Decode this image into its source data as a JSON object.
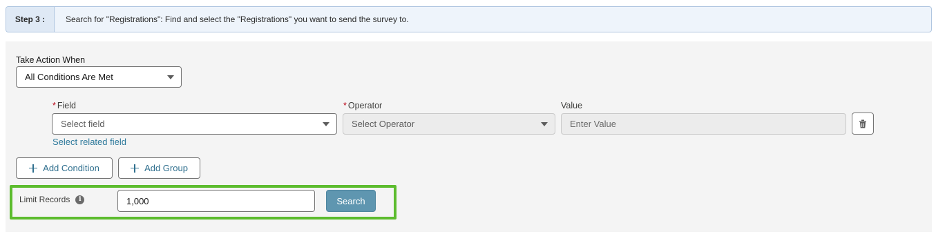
{
  "step": {
    "label": "Step 3 :",
    "instruction": "Search for \"Registrations\": Find and select the \"Registrations\" you want to send the survey to."
  },
  "take_action": {
    "label": "Take Action When",
    "value": "All Conditions Are Met"
  },
  "condition": {
    "field_label": "Field",
    "field_placeholder": "Select field",
    "related_link": "Select related field",
    "operator_label": "Operator",
    "operator_placeholder": "Select Operator",
    "value_label": "Value",
    "value_placeholder": "Enter Value",
    "required_marker": "*"
  },
  "actions": {
    "add_condition": "Add Condition",
    "add_group": "Add Group"
  },
  "limit": {
    "label": "Limit Records",
    "info_glyph": "i",
    "value": "1,000",
    "search_label": "Search"
  },
  "colors": {
    "highlight": "#5cbc2e",
    "search_button": "#5f96b0",
    "link": "#2f7a9c",
    "required": "#ba0517"
  },
  "icons": [
    "chevron-down-icon",
    "trash-icon",
    "plus-icon",
    "info-icon"
  ]
}
